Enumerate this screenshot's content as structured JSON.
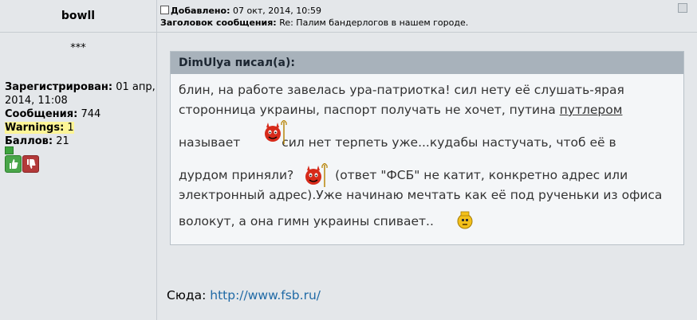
{
  "author": {
    "name": "bowll",
    "rank": "***"
  },
  "user_info": {
    "registered_label": "Зарегистрирован:",
    "registered_value": "01 апр, 2014, 11:08",
    "messages_label": "Сообщения:",
    "messages_value": "744",
    "warnings_label": "Warnings:",
    "warnings_value": "1",
    "points_label": "Баллов:",
    "points_value": "21"
  },
  "post": {
    "added_label": "Добавлено:",
    "added_value": "07 окт, 2014, 10:59",
    "subject_label": "Заголовок сообщения:",
    "subject_value": "Re: Палим бандерлогов в нашем городе."
  },
  "quote": {
    "author": "DimUlya писал(а):",
    "line1": "блин, на работе завелась ура-патриотка! сил нету её слушать-ярая",
    "line2a": "сторонница украины, паспорт получать не хочет, путина ",
    "line2b": "путлером",
    "line3": "называет",
    "line3b": "сил нет терпеть уже...кудабы настучать, чтоб её в",
    "line4a": "дурдом приняли?",
    "line4b": "(ответ \"ФСБ\" не катит, конкретно адрес или",
    "line5": "электронный адрес).Уже начинаю мечтать как её под рученьки из офиса",
    "line6": "волокут, а она гимн украины спивает.."
  },
  "reply": {
    "prefix": "Сюда:",
    "link": "http://www.fsb.ru/"
  }
}
